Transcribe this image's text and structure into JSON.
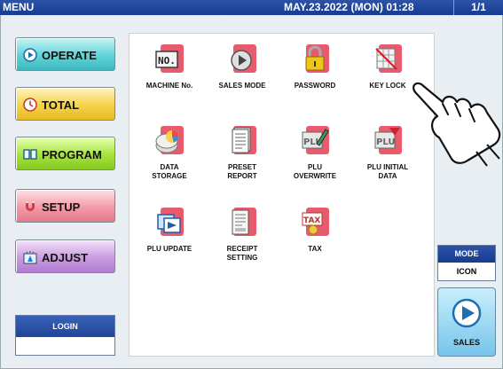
{
  "topbar": {
    "menu": "MENU",
    "datetime": "MAY.23.2022 (MON) 01:28",
    "page": "1/1"
  },
  "left_menu": [
    {
      "label": "OPERATE",
      "icon": "play-circle-icon"
    },
    {
      "label": "TOTAL",
      "icon": "clock-icon"
    },
    {
      "label": "PROGRAM",
      "icon": "book-icon"
    },
    {
      "label": "SETUP",
      "icon": "magnet-icon"
    },
    {
      "label": "ADJUST",
      "icon": "scale-icon"
    }
  ],
  "login": {
    "label": "LOGIN",
    "value": ""
  },
  "menu_items": [
    {
      "label": "MACHINE No.",
      "icon": "machine-number-icon"
    },
    {
      "label": "SALES MODE",
      "icon": "sales-mode-icon"
    },
    {
      "label": "PASSWORD",
      "icon": "padlock-icon"
    },
    {
      "label": "KEY LOCK",
      "icon": "key-lock-icon"
    },
    {
      "label": "DATA STORAGE",
      "line1": "DATA",
      "line2": "STORAGE",
      "icon": "pie-storage-icon"
    },
    {
      "label": "PRESET REPORT",
      "line1": "PRESET",
      "line2": "REPORT",
      "icon": "report-document-icon"
    },
    {
      "label": "PLU OVERWRITE",
      "line1": "PLU",
      "line2": "OVERWRITE",
      "icon": "plu-overwrite-icon"
    },
    {
      "label": "PLU INITIAL DATA",
      "line1": "PLU INITIAL",
      "line2": "DATA",
      "icon": "plu-initial-icon"
    },
    {
      "label": "PLU UPDATE",
      "icon": "plu-update-icon"
    },
    {
      "label": "RECEIPT SETTING",
      "line1": "RECEIPT",
      "line2": "SETTING",
      "icon": "receipt-icon"
    },
    {
      "label": "TAX",
      "icon": "tax-icon"
    }
  ],
  "mode": {
    "title": "MODE",
    "value": "ICON"
  },
  "sales_button": {
    "label": "SALES",
    "icon": "play-circle-icon"
  },
  "colors": {
    "topbar": "#1f4598",
    "tile_red": "#e85b6c"
  }
}
